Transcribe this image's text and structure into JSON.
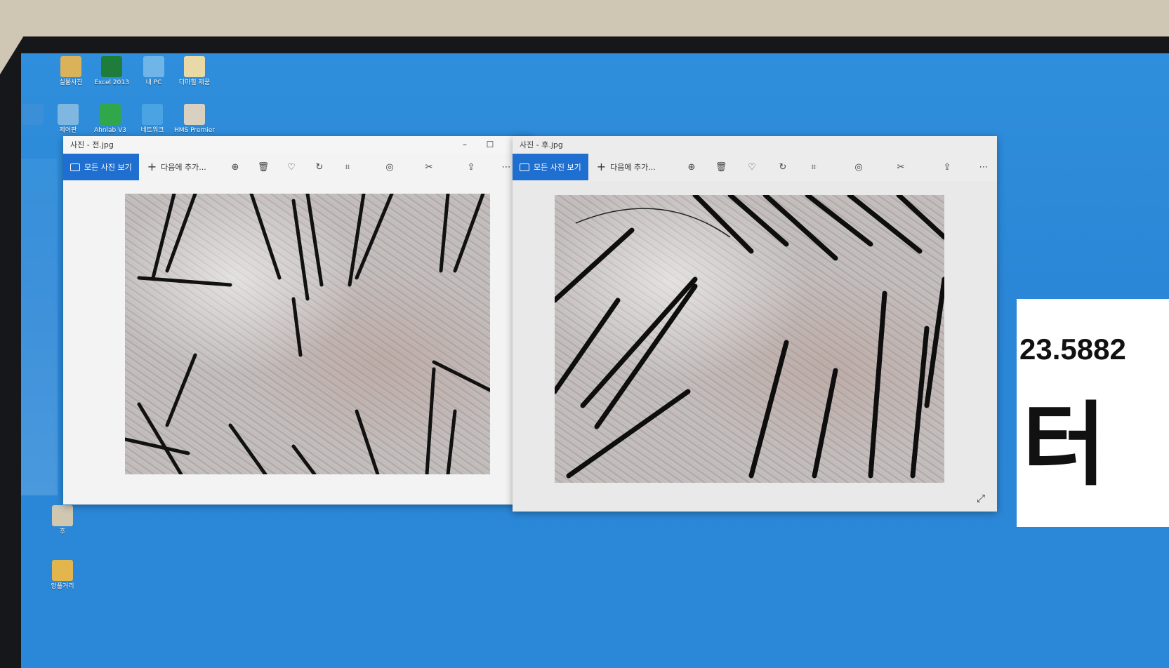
{
  "desktop": {
    "icons": [
      {
        "label": "실물사진",
        "color": "#d9b25a"
      },
      {
        "label": "Excel 2013",
        "color": "#1e7d3a"
      },
      {
        "label": "내 PC",
        "color": "#6fb5e8"
      },
      {
        "label": "더마힐 제품",
        "color": "#e8d9a6"
      },
      {
        "label": "",
        "color": "#3a8fd8"
      },
      {
        "label": "제어판",
        "color": "#7fb7e0"
      },
      {
        "label": "Ahnlab V3",
        "color": "#2fa74a"
      },
      {
        "label": "네트워크",
        "color": "#4aa3e3"
      },
      {
        "label": "HMS Premier",
        "color": "#d8d0c0"
      },
      {
        "label": "후",
        "color": "#cfc7b0"
      },
      {
        "label": "앙플거리",
        "color": "#e2b64d"
      }
    ]
  },
  "windows": [
    {
      "title": "사진 - 전.jpg",
      "all_photos_label": "모든 사진 보기",
      "add_to_label": "다음에 추가...",
      "minimize": "–",
      "maximize": "☐",
      "close": "✕"
    },
    {
      "title": "사진 - 후.jpg",
      "all_photos_label": "모든 사진 보기",
      "add_to_label": "다음에 추가..."
    }
  ],
  "toolbar_icons": [
    "zoom-icon",
    "delete-icon",
    "favorite-icon",
    "rotate-icon",
    "crop-icon",
    "enhance-icon",
    "edit-icon",
    "share-icon",
    "more-icon"
  ],
  "side_card": {
    "number": "23.5882",
    "char": "터"
  },
  "colors": {
    "desktop_blue": "#2b88d8",
    "accent_blue": "#1f6fd0",
    "window_bg": "#f3f3f3"
  }
}
